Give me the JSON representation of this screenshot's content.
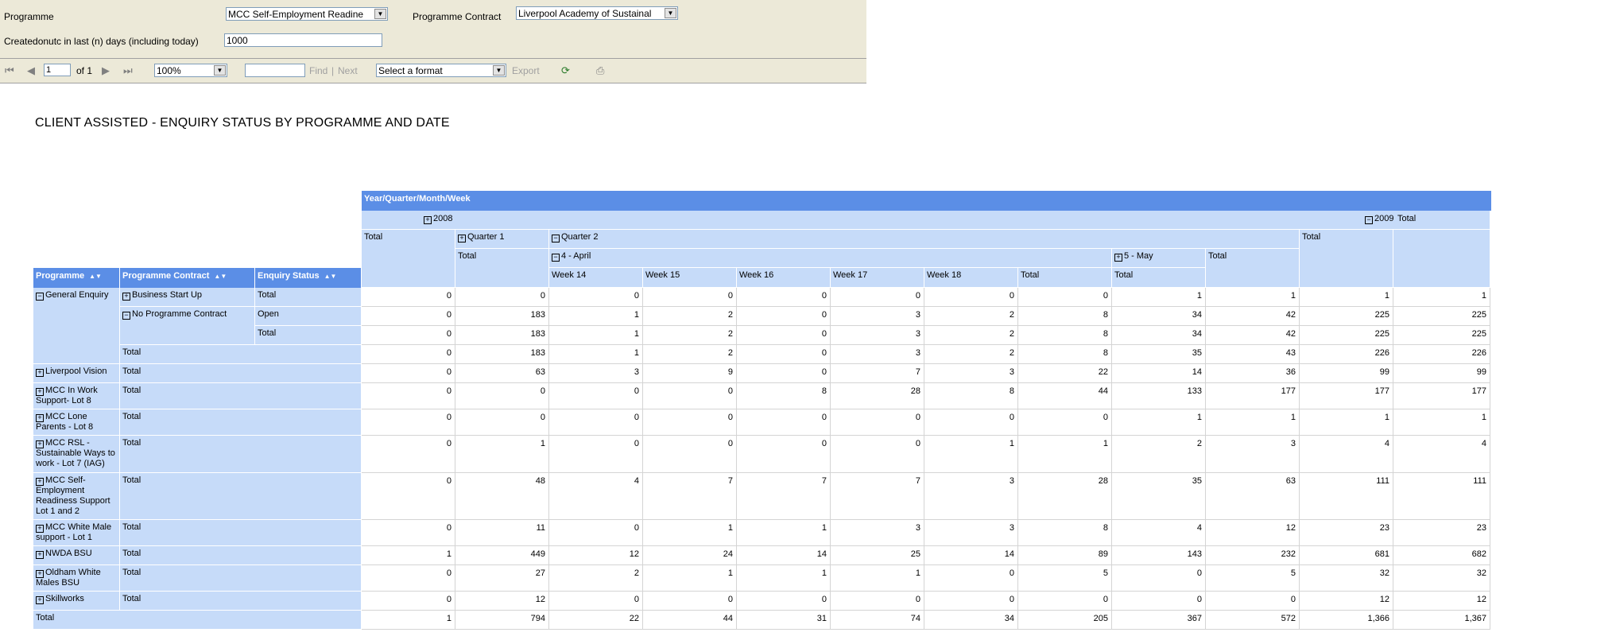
{
  "params": {
    "programme_label": "Programme",
    "programme_value": "MCC Self-Employment Readine",
    "contract_label": "Programme Contract",
    "contract_value": "Liverpool Academy of Sustainal",
    "days_label": "Createdonutc in last (n) days (including today)",
    "days_value": "1000"
  },
  "toolbar": {
    "page_value": "1",
    "of_label": "of 1",
    "zoom_value": "100%",
    "find_value": "",
    "find_label": "Find",
    "sep": "|",
    "next_label": "Next",
    "format_value": "Select a format",
    "export_label": "Export"
  },
  "report": {
    "title": "CLIENT ASSISTED - ENQUIRY STATUS BY PROGRAMME AND DATE",
    "col_dim_header": "Year/Quarter/Month/Week",
    "row_headers": [
      "Programme",
      "Programme Contract",
      "Enquiry Status"
    ],
    "year_2008": "2008",
    "year_2009": "2009",
    "total": "Total",
    "quarter1": "Quarter 1",
    "quarter2": "Quarter 2",
    "april": "4 - April",
    "may": "5 - May",
    "weeks": [
      "Week 14",
      "Week 15",
      "Week 16",
      "Week 17",
      "Week 18"
    ],
    "rows": [
      {
        "programme": "General Enquiry",
        "contract": "Business Start Up",
        "status": "Total",
        "values": [
          "0",
          "0",
          "0",
          "0",
          "0",
          "0",
          "0",
          "0",
          "1",
          "1",
          "1",
          "1"
        ]
      },
      {
        "programme": "",
        "contract": "No Programme Contract",
        "status": "Open",
        "values": [
          "0",
          "183",
          "1",
          "2",
          "0",
          "3",
          "2",
          "8",
          "34",
          "42",
          "225",
          "225"
        ]
      },
      {
        "programme": "",
        "contract": "",
        "status": "Total",
        "values": [
          "0",
          "183",
          "1",
          "2",
          "0",
          "3",
          "2",
          "8",
          "34",
          "42",
          "225",
          "225"
        ]
      },
      {
        "programme": "",
        "contract": "Total",
        "status": "",
        "values": [
          "0",
          "183",
          "1",
          "2",
          "0",
          "3",
          "2",
          "8",
          "35",
          "43",
          "226",
          "226"
        ]
      },
      {
        "programme": "Liverpool Vision",
        "contract": "Total",
        "status": "",
        "values": [
          "0",
          "63",
          "3",
          "9",
          "0",
          "7",
          "3",
          "22",
          "14",
          "36",
          "99",
          "99"
        ]
      },
      {
        "programme": "MCC In Work Support- Lot 8",
        "contract": "Total",
        "status": "",
        "values": [
          "0",
          "0",
          "0",
          "0",
          "8",
          "28",
          "8",
          "44",
          "133",
          "177",
          "177",
          "177"
        ]
      },
      {
        "programme": "MCC Lone Parents - Lot 8",
        "contract": "Total",
        "status": "",
        "values": [
          "0",
          "0",
          "0",
          "0",
          "0",
          "0",
          "0",
          "0",
          "1",
          "1",
          "1",
          "1"
        ]
      },
      {
        "programme": "MCC RSL - Sustainable Ways to work - Lot 7 (IAG)",
        "contract": "Total",
        "status": "",
        "values": [
          "0",
          "1",
          "0",
          "0",
          "0",
          "0",
          "1",
          "1",
          "2",
          "3",
          "4",
          "4"
        ]
      },
      {
        "programme": "MCC Self-Employment Readiness Support Lot 1 and 2",
        "contract": "Total",
        "status": "",
        "values": [
          "0",
          "48",
          "4",
          "7",
          "7",
          "7",
          "3",
          "28",
          "35",
          "63",
          "111",
          "111"
        ]
      },
      {
        "programme": "MCC White Male support - Lot 1",
        "contract": "Total",
        "status": "",
        "values": [
          "0",
          "11",
          "0",
          "1",
          "1",
          "3",
          "3",
          "8",
          "4",
          "12",
          "23",
          "23"
        ]
      },
      {
        "programme": "NWDA BSU",
        "contract": "Total",
        "status": "",
        "values": [
          "1",
          "449",
          "12",
          "24",
          "14",
          "25",
          "14",
          "89",
          "143",
          "232",
          "681",
          "682"
        ]
      },
      {
        "programme": "Oldham White Males BSU",
        "contract": "Total",
        "status": "",
        "values": [
          "0",
          "27",
          "2",
          "1",
          "1",
          "1",
          "0",
          "5",
          "0",
          "5",
          "32",
          "32"
        ]
      },
      {
        "programme": "Skillworks",
        "contract": "Total",
        "status": "",
        "values": [
          "0",
          "12",
          "0",
          "0",
          "0",
          "0",
          "0",
          "0",
          "0",
          "0",
          "12",
          "12"
        ]
      },
      {
        "programme": "Total",
        "contract": "",
        "status": "",
        "values": [
          "1",
          "794",
          "22",
          "44",
          "31",
          "74",
          "34",
          "205",
          "367",
          "572",
          "1,366",
          "1,367"
        ]
      }
    ]
  }
}
